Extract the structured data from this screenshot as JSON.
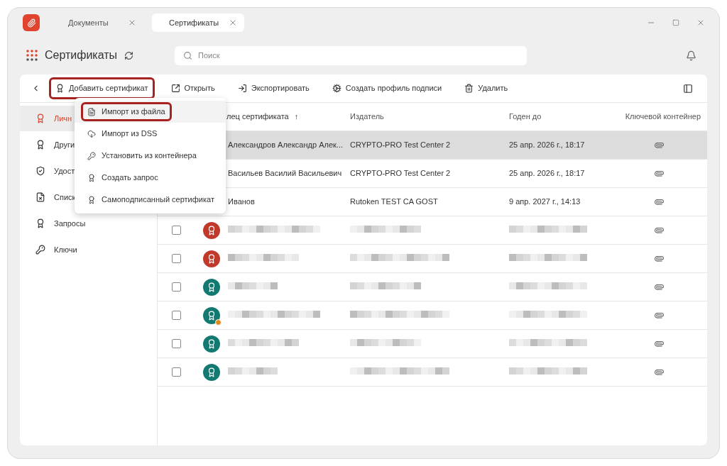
{
  "window": {
    "tabs": [
      {
        "label": "Документы",
        "selected": false
      },
      {
        "label": "Сертификаты",
        "selected": true
      }
    ]
  },
  "header": {
    "title": "Сертификаты",
    "search": {
      "placeholder": "Поиск"
    }
  },
  "toolbar": [
    {
      "label": "Добавить сертификат",
      "outlined": true
    },
    {
      "label": "Открыть",
      "outlined": false
    },
    {
      "label": "Экспортировать",
      "outlined": false
    },
    {
      "label": "Создать профиль подписи",
      "outlined": false
    },
    {
      "label": "Удалить",
      "outlined": false
    }
  ],
  "sidebar": {
    "items": [
      {
        "label": "Личн",
        "selected": true
      },
      {
        "label": "Други",
        "selected": false
      },
      {
        "label": "Удост",
        "selected": false
      },
      {
        "label": "Списк",
        "selected": false
      },
      {
        "label": "Запросы",
        "selected": false
      },
      {
        "label": "Ключи",
        "selected": false
      }
    ]
  },
  "menu": [
    {
      "label": "Импорт из файла",
      "selected": true,
      "outlined": true
    },
    {
      "label": "Импорт из DSS",
      "selected": false,
      "outlined": false
    },
    {
      "label": "Установить из контейнера",
      "selected": false,
      "outlined": false
    },
    {
      "label": "Создать запрос",
      "selected": false,
      "outlined": false
    },
    {
      "label": "Самоподписанный сертификат",
      "selected": false,
      "outlined": false
    }
  ],
  "table": {
    "columns": [
      "лец сертификата",
      "Издатель",
      "Годен до",
      "Ключевой контейнер"
    ],
    "sort_arrow": "↑",
    "rows": [
      {
        "kind": "text",
        "selected": true,
        "owner": "Александров Александр Алек...",
        "issuer": "CRYPTO-PRO Test Center 2",
        "valid_until": "25 апр. 2026 г., 18:17"
      },
      {
        "kind": "text",
        "selected": false,
        "owner": "Васильев Василий Васильевич",
        "issuer": "CRYPTO-PRO Test Center 2",
        "valid_until": "25 апр. 2026 г., 18:17"
      },
      {
        "kind": "text",
        "selected": false,
        "owner": "Иванов",
        "issuer": "Rutoken TEST CA GOST",
        "valid_until": "9 апр. 2027 г., 14:13"
      },
      {
        "kind": "redacted",
        "selected": false,
        "checked": false,
        "color": "#c0392b",
        "warning": false
      },
      {
        "kind": "redacted",
        "selected": false,
        "checked": false,
        "color": "#c0392b",
        "warning": false
      },
      {
        "kind": "redacted",
        "selected": false,
        "checked": false,
        "color": "#127a70",
        "warning": false
      },
      {
        "kind": "redacted",
        "selected": false,
        "checked": false,
        "color": "#127a70",
        "warning": true
      },
      {
        "kind": "redacted",
        "selected": false,
        "checked": false,
        "color": "#127a70",
        "warning": false
      },
      {
        "kind": "redacted",
        "selected": false,
        "checked": false,
        "color": "#127a70",
        "warning": false
      }
    ]
  }
}
